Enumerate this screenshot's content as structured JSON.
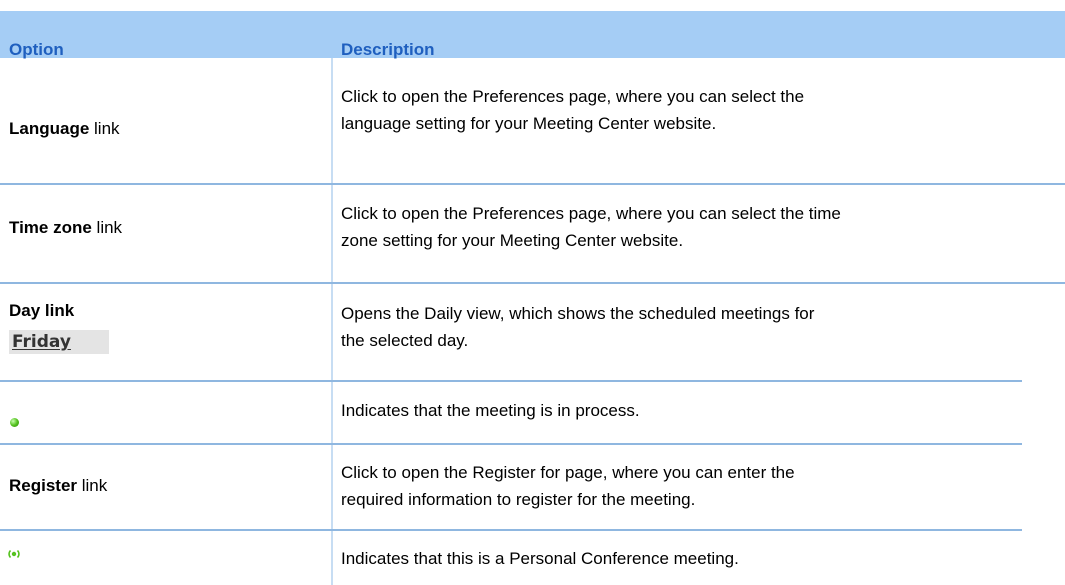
{
  "header": {
    "option": "Option",
    "description": "Description"
  },
  "rows": [
    {
      "option_bold": "Language",
      "option_rest": " link",
      "description_line1": "Click to open the Preferences page, where you can select the",
      "description_line2": "language setting for your Meeting Center website."
    },
    {
      "option_bold": "Time zone",
      "option_rest": " link",
      "description_line1": "Click to open the Preferences page, where you can select the time",
      "description_line2": "zone setting for your Meeting Center website."
    },
    {
      "option_bold": "Day link",
      "button_label": "Friday",
      "description_line1": "Opens the Daily view, which shows the scheduled meetings for",
      "description_line2": "the selected day."
    },
    {
      "icon": "in-process-dot-icon",
      "description_line1": "Indicates that the meeting is in process."
    },
    {
      "option_bold": "Register",
      "option_rest": " link",
      "description_line1": "Click to open the Register for page, where you can enter the",
      "description_line2": "required information to register for the meeting."
    },
    {
      "icon": "personal-conference-icon",
      "description_line1": "Indicates that this is a Personal Conference meeting."
    }
  ],
  "colors": {
    "header_bg": "#a5cdf5",
    "header_text": "#1f5fbf",
    "row_rule": "#8fb7e0",
    "status_green": "#55c21f"
  }
}
